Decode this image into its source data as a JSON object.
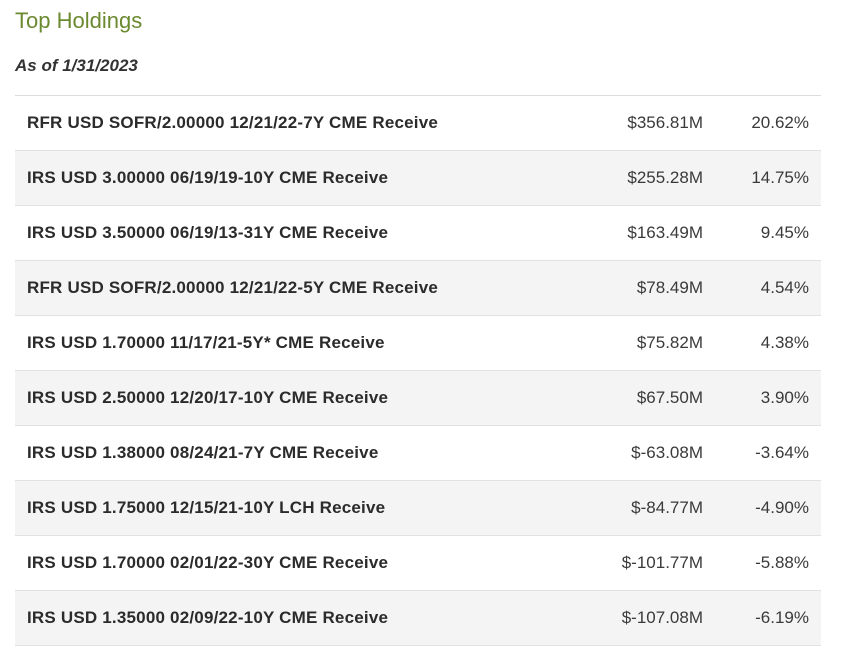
{
  "header": {
    "title": "Top Holdings",
    "as_of": "As of 1/31/2023"
  },
  "holdings": [
    {
      "name": "RFR USD SOFR/2.00000 12/21/22-7Y CME Receive",
      "value": "$356.81M",
      "pct": "20.62%"
    },
    {
      "name": "IRS USD 3.00000 06/19/19-10Y CME Receive",
      "value": "$255.28M",
      "pct": "14.75%"
    },
    {
      "name": "IRS USD 3.50000 06/19/13-31Y CME Receive",
      "value": "$163.49M",
      "pct": "9.45%"
    },
    {
      "name": "RFR USD SOFR/2.00000 12/21/22-5Y CME Receive",
      "value": "$78.49M",
      "pct": "4.54%"
    },
    {
      "name": "IRS USD 1.70000 11/17/21-5Y* CME Receive",
      "value": "$75.82M",
      "pct": "4.38%"
    },
    {
      "name": "IRS USD 2.50000 12/20/17-10Y CME Receive",
      "value": "$67.50M",
      "pct": "3.90%"
    },
    {
      "name": "IRS USD 1.38000 08/24/21-7Y CME Receive",
      "value": "$-63.08M",
      "pct": "-3.64%"
    },
    {
      "name": "IRS USD 1.75000 12/15/21-10Y LCH Receive",
      "value": "$-84.77M",
      "pct": "-4.90%"
    },
    {
      "name": "IRS USD 1.70000 02/01/22-30Y CME Receive",
      "value": "$-101.77M",
      "pct": "-5.88%"
    },
    {
      "name": "IRS USD 1.35000 02/09/22-10Y CME Receive",
      "value": "$-107.08M",
      "pct": "-6.19%"
    }
  ],
  "colors": {
    "title": "#6b8a2f",
    "row_alt_bg": "#f4f4f4",
    "divider": "#e2e2e2"
  }
}
